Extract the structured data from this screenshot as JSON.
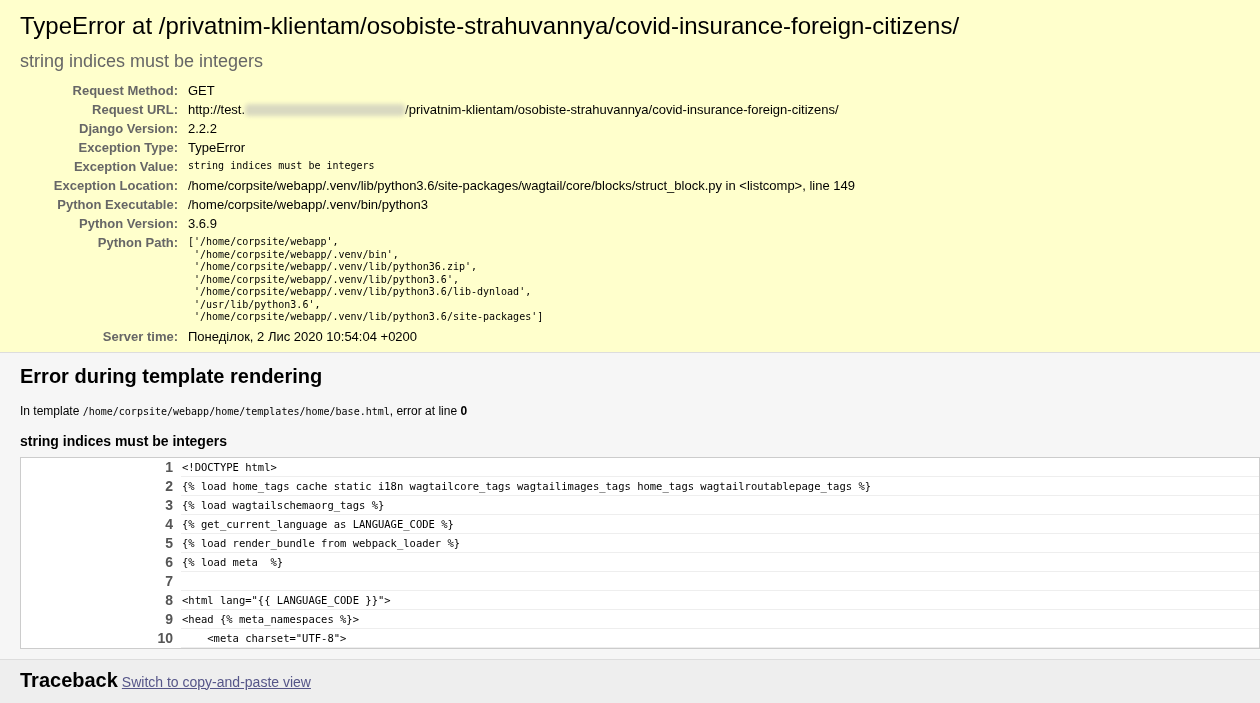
{
  "summary": {
    "title": "TypeError at /privatnim-klientam/osobiste-strahuvannya/covid-insurance-foreign-citizens/",
    "subtitle": "string indices must be integers",
    "meta": [
      {
        "label": "Request Method:",
        "kind": "text",
        "value": "GET"
      },
      {
        "label": "Request URL:",
        "kind": "url",
        "prefix": "http://test.",
        "value": "/privatnim-klientam/osobiste-strahuvannya/covid-insurance-foreign-citizens/"
      },
      {
        "label": "Django Version:",
        "kind": "text",
        "value": "2.2.2"
      },
      {
        "label": "Exception Type:",
        "kind": "text",
        "value": "TypeError"
      },
      {
        "label": "Exception Value:",
        "kind": "code",
        "value": "string indices must be integers"
      },
      {
        "label": "Exception Location:",
        "kind": "text",
        "value": "/home/corpsite/webapp/.venv/lib/python3.6/site-packages/wagtail/core/blocks/struct_block.py in <listcomp>, line 149"
      },
      {
        "label": "Python Executable:",
        "kind": "text",
        "value": "/home/corpsite/webapp/.venv/bin/python3"
      },
      {
        "label": "Python Version:",
        "kind": "text",
        "value": "3.6.9"
      },
      {
        "label": "Python Path:",
        "kind": "code",
        "value": "['/home/corpsite/webapp',\n '/home/corpsite/webapp/.venv/bin',\n '/home/corpsite/webapp/.venv/lib/python36.zip',\n '/home/corpsite/webapp/.venv/lib/python3.6',\n '/home/corpsite/webapp/.venv/lib/python3.6/lib-dynload',\n '/usr/lib/python3.6',\n '/home/corpsite/webapp/.venv/lib/python3.6/site-packages']"
      },
      {
        "label": "Server time:",
        "kind": "text",
        "value": "Понеділок, 2 Лис 2020 10:54:04 +0200"
      }
    ]
  },
  "template": {
    "heading": "Error during template rendering",
    "info": {
      "before": "In template",
      "file": "/home/corpsite/webapp/home/templates/home/base.html",
      "after": ", error at line **0**"
    },
    "subheading": "string indices must be integers",
    "lines": [
      {
        "number": "1",
        "code": "<!DOCTYPE html>"
      },
      {
        "number": "2",
        "code": "{% load home_tags cache static i18n wagtailcore_tags wagtailimages_tags home_tags wagtailroutablepage_tags %}"
      },
      {
        "number": "3",
        "code": "{% load wagtailschemaorg_tags %}"
      },
      {
        "number": "4",
        "code": "{% get_current_language as LANGUAGE_CODE %}"
      },
      {
        "number": "5",
        "code": "{% load render_bundle from webpack_loader %}"
      },
      {
        "number": "6",
        "code": "{% load meta  %}"
      },
      {
        "number": "7"
      },
      {
        "number": "8",
        "code": "<html lang=\"{{ LANGUAGE_CODE }}\">"
      },
      {
        "number": "9",
        "code": "<head {% meta_namespaces %}>"
      },
      {
        "number": "10",
        "code": "    <meta charset=\"UTF-8\">"
      }
    ]
  },
  "traceback": {
    "heading": "Traceback",
    "link": "Switch to copy-and-paste view"
  }
}
